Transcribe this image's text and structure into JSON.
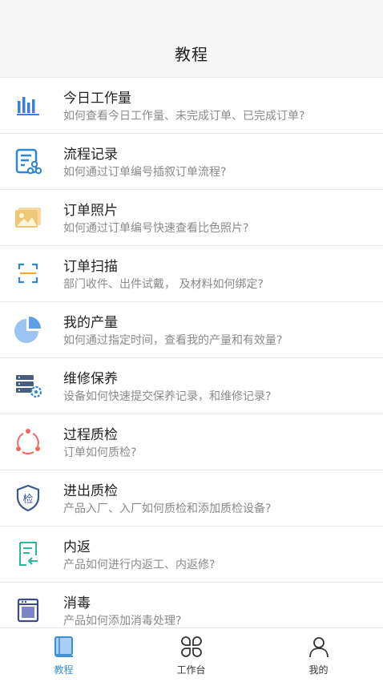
{
  "header": {
    "title": "教程"
  },
  "items": [
    {
      "title": "今日工作量",
      "desc": "如何查看今日工作量、未完成订单、已完成订单?",
      "icon": "bar-chart-icon"
    },
    {
      "title": "流程记录",
      "desc": "如何通过订单编号插叙订单流程?",
      "icon": "process-record-icon"
    },
    {
      "title": "订单照片",
      "desc": "如何通过订单编号快速查看比色照片?",
      "icon": "photo-icon"
    },
    {
      "title": "订单扫描",
      "desc": "部门收件、出件试戴， 及材料如何绑定?",
      "icon": "scan-icon"
    },
    {
      "title": "我的产量",
      "desc": "如何通过指定时间，查看我的产量和有效量?",
      "icon": "pie-chart-icon"
    },
    {
      "title": "维修保养",
      "desc": "设备如何快速提交保养记录，和维修记录?",
      "icon": "server-gear-icon"
    },
    {
      "title": "过程质检",
      "desc": "订单如何质检?",
      "icon": "cycle-icon"
    },
    {
      "title": "进出质检",
      "desc": "产品入厂、入厂如何质检和添加质检设备?",
      "icon": "shield-inspect-icon"
    },
    {
      "title": "内返",
      "desc": "产品如何进行内返工、内返修?",
      "icon": "return-doc-icon"
    },
    {
      "title": "消毒",
      "desc": "产品如何添加消毒处理?",
      "icon": "oven-icon"
    }
  ],
  "shield_char": "检",
  "tabs": [
    {
      "label": "教程",
      "icon": "book-icon",
      "active": true
    },
    {
      "label": "工作台",
      "icon": "grid-clover-icon",
      "active": false
    },
    {
      "label": "我的",
      "icon": "user-icon",
      "active": false
    }
  ],
  "colors": {
    "accent": "#3d8fd6",
    "header_bg": "#f6f6f6"
  }
}
